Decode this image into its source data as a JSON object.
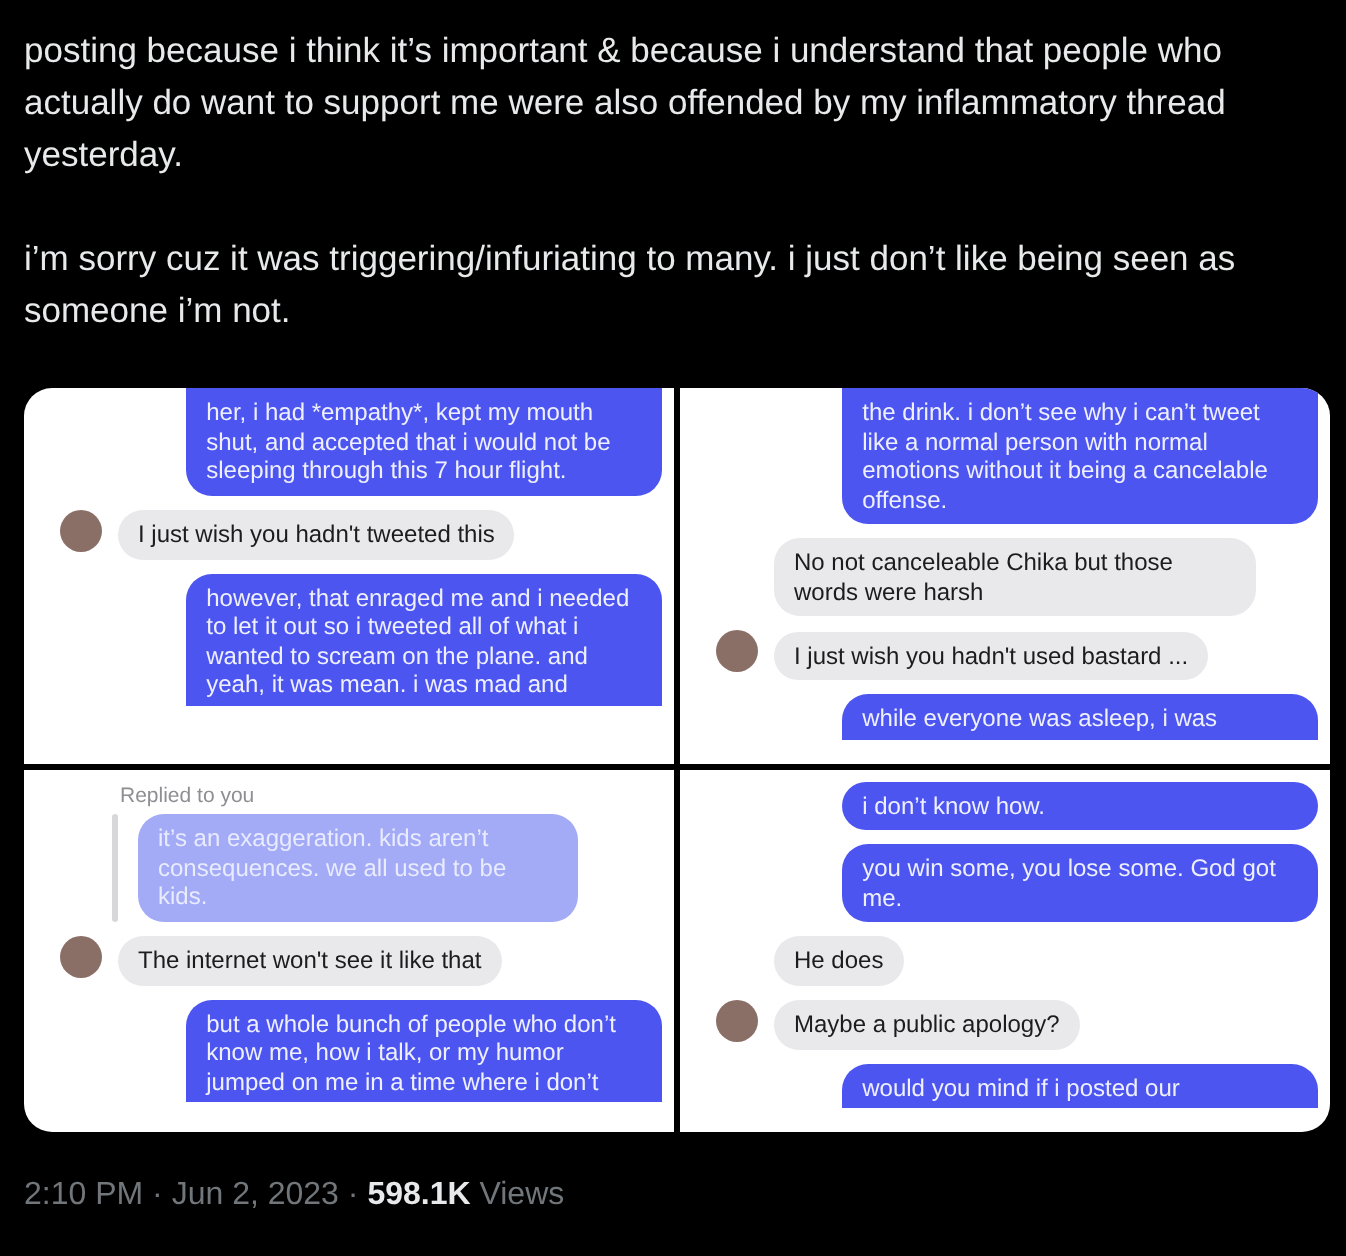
{
  "tweet": {
    "paragraphs": [
      "posting because i think it’s important & because i understand that people who actually do want to support me were also offended by my inflammatory thread yesterday.",
      "i’m sorry cuz it was triggering/infuriating to many. i just don’t like being seen as someone i’m not."
    ]
  },
  "screenshots": [
    {
      "messages": [
        {
          "kind": "sent",
          "text": "her, i had *empathy*, kept my mouth shut, and accepted that i would not be sleeping through this 7 hour flight.",
          "cut_top": true
        },
        {
          "kind": "received",
          "text": "I just wish you hadn't tweeted this",
          "avatar": true
        },
        {
          "kind": "sent",
          "text": "however, that enraged me and i needed to let it out so i tweeted all of what i wanted to scream on the plane. and yeah, it was mean. i was mad and",
          "cut_bottom": true
        }
      ]
    },
    {
      "messages": [
        {
          "kind": "sent",
          "text": "the drink. i don’t see why i can’t tweet like a normal person with normal emotions without it being a cancelable offense.",
          "cut_top": true
        },
        {
          "kind": "received",
          "text": "No not canceleable Chika but those words were harsh",
          "avatar": false
        },
        {
          "kind": "received",
          "text": "I just wish you hadn't used bastard ...",
          "avatar": true
        },
        {
          "kind": "sent",
          "text": "while everyone was asleep, i was",
          "cut_bottom": true
        }
      ]
    },
    {
      "messages": [
        {
          "kind": "reply_label",
          "text": "Replied to you"
        },
        {
          "kind": "quote",
          "text": "it’s an exaggeration. kids aren’t consequences. we all used to be kids."
        },
        {
          "kind": "received",
          "text": "The internet won't see it like that",
          "avatar": true
        },
        {
          "kind": "sent",
          "text": "but a whole bunch of people who don’t know me, how i talk, or my humor jumped on me in a time where i don’t",
          "cut_bottom": true
        }
      ]
    },
    {
      "messages": [
        {
          "kind": "sent",
          "text": "i don’t know how."
        },
        {
          "kind": "sent",
          "text": "you win some, you lose some. God got me."
        },
        {
          "kind": "received",
          "text": "He does",
          "avatar": false
        },
        {
          "kind": "received",
          "text": "Maybe a public apology?",
          "avatar": true
        },
        {
          "kind": "sent",
          "text": "would you mind if i posted our",
          "cut_bottom": true
        }
      ]
    }
  ],
  "meta": {
    "time": "2:10 PM",
    "separators": [
      "·",
      "·"
    ],
    "date": "Jun 2, 2023",
    "views": "598.1K",
    "views_label": "Views"
  }
}
